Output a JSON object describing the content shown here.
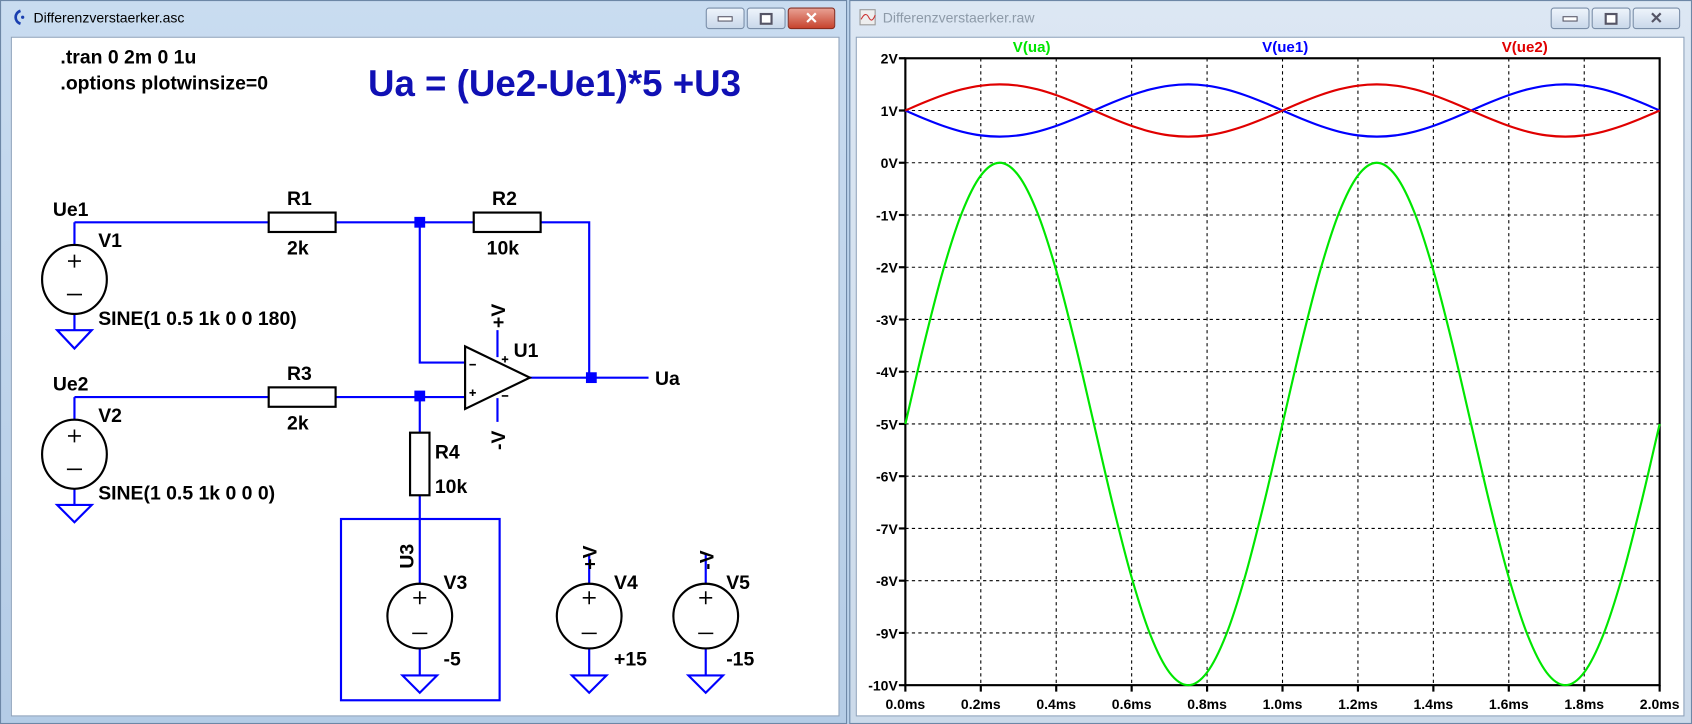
{
  "schematic_window": {
    "title": "Differenzverstaerker.asc",
    "directives": [
      ".tran 0 2m 0 1u",
      ".options plotwinsize=0"
    ],
    "formula": "Ua = (Ue2-Ue1)*5 +U3",
    "labels": {
      "ue1": "Ue1",
      "ue2": "Ue2",
      "ua": "Ua",
      "u3": "U3",
      "r1": "R1",
      "r1_val": "2k",
      "r2": "R2",
      "r2_val": "10k",
      "r3": "R3",
      "r3_val": "2k",
      "r4": "R4",
      "r4_val": "10k",
      "u1": "U1",
      "v1": "V1",
      "v1_val": "SINE(1 0.5 1k 0 0 180)",
      "v2": "V2",
      "v2_val": "SINE(1 0.5 1k 0 0 0)",
      "v3": "V3",
      "v3_val": "-5",
      "v4": "V4",
      "v4_val": "+15",
      "v5": "V5",
      "v5_val": "-15",
      "vplus": "+V",
      "vminus": "-V",
      "pin_plus": "+",
      "pin_minus": "−"
    },
    "colors": {
      "wire": "#0000ff",
      "formula": "#1010b4"
    }
  },
  "plot_window": {
    "title": "Differenzverstaerker.raw"
  },
  "chart_data": {
    "type": "line",
    "xlabel": "",
    "ylabel": "",
    "xlim": [
      0,
      2.0
    ],
    "ylim": [
      -10,
      2
    ],
    "grid": true,
    "legend_placement": "top",
    "x_ticks": [
      "0.0ms",
      "0.2ms",
      "0.4ms",
      "0.6ms",
      "0.8ms",
      "1.0ms",
      "1.2ms",
      "1.4ms",
      "1.6ms",
      "1.8ms",
      "2.0ms"
    ],
    "y_ticks": [
      "2V",
      "1V",
      "0V",
      "-1V",
      "-2V",
      "-3V",
      "-4V",
      "-5V",
      "-6V",
      "-7V",
      "-8V",
      "-9V",
      "-10V"
    ],
    "x": [
      0,
      0.05,
      0.1,
      0.15,
      0.2,
      0.25,
      0.3,
      0.35,
      0.4,
      0.45,
      0.5,
      0.55,
      0.6,
      0.65,
      0.7,
      0.75,
      0.8,
      0.85,
      0.9,
      0.95,
      1.0,
      1.05,
      1.1,
      1.15,
      1.2,
      1.25,
      1.3,
      1.35,
      1.4,
      1.45,
      1.5,
      1.55,
      1.6,
      1.65,
      1.7,
      1.75,
      1.8,
      1.85,
      1.9,
      1.95,
      2.0
    ],
    "series": [
      {
        "name": "V(ua)",
        "color": "#00e600",
        "values": [
          -5,
          -3.455,
          -2.061,
          -0.955,
          -0.245,
          0,
          -0.245,
          -0.955,
          -2.061,
          -3.455,
          -5,
          -6.545,
          -7.939,
          -9.045,
          -9.755,
          -10,
          -9.755,
          -9.045,
          -7.939,
          -6.545,
          -5,
          -3.455,
          -2.061,
          -0.955,
          -0.245,
          0,
          -0.245,
          -0.955,
          -2.061,
          -3.455,
          -5,
          -6.545,
          -7.939,
          -9.045,
          -9.755,
          -10,
          -9.755,
          -9.045,
          -7.939,
          -6.545,
          -5
        ]
      },
      {
        "name": "V(ue1)",
        "color": "#0000ff",
        "values": [
          1,
          0.845,
          0.706,
          0.595,
          0.524,
          0.5,
          0.524,
          0.595,
          0.706,
          0.845,
          1,
          1.155,
          1.294,
          1.405,
          1.476,
          1.5,
          1.476,
          1.405,
          1.294,
          1.155,
          1,
          0.845,
          0.706,
          0.595,
          0.524,
          0.5,
          0.524,
          0.595,
          0.706,
          0.845,
          1,
          1.155,
          1.294,
          1.405,
          1.476,
          1.5,
          1.476,
          1.405,
          1.294,
          1.155,
          1
        ]
      },
      {
        "name": "V(ue2)",
        "color": "#e00000",
        "values": [
          1,
          1.155,
          1.294,
          1.405,
          1.476,
          1.5,
          1.476,
          1.405,
          1.294,
          1.155,
          1,
          0.845,
          0.706,
          0.595,
          0.524,
          0.5,
          0.524,
          0.595,
          0.706,
          0.845,
          1,
          1.155,
          1.294,
          1.405,
          1.476,
          1.5,
          1.476,
          1.405,
          1.294,
          1.155,
          1,
          0.845,
          0.706,
          0.595,
          0.524,
          0.5,
          0.524,
          0.595,
          0.706,
          0.845,
          1
        ]
      }
    ]
  }
}
